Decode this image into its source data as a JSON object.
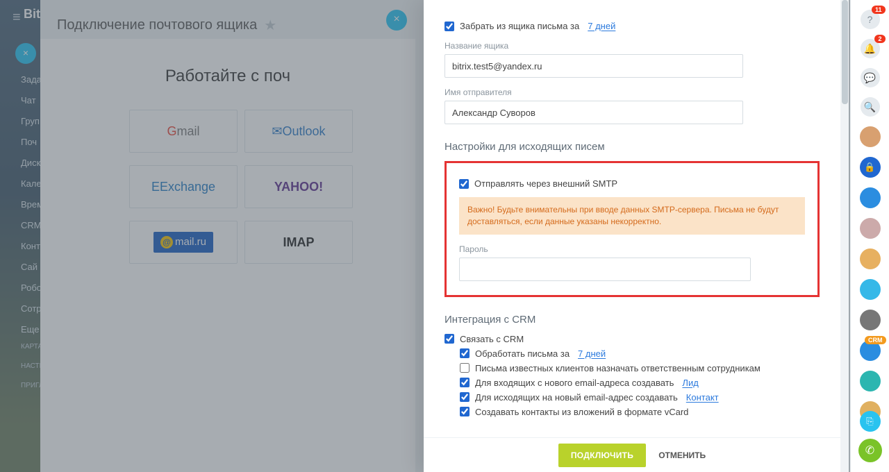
{
  "sidebar": {
    "logo": "Bit",
    "items": [
      "Зада",
      "Чат",
      "Груп",
      "Поч",
      "Диск",
      "Кале",
      "Врем",
      "CRM",
      "Конт",
      "Сай",
      "Робо",
      "Сотр",
      "Еще"
    ],
    "footer": [
      "КАРТА",
      "НАСТР",
      "ПРИГЛ"
    ]
  },
  "modal": {
    "title": "Подключение почтового ящика",
    "h1": "Работайте с поч",
    "providers": [
      "Gmail",
      "Outlook",
      "Exchange",
      "YAHOO!",
      "@mail.ru",
      "IMAP"
    ]
  },
  "panel": {
    "fetch_prefix": "Забрать из ящика письма за",
    "fetch_link": "7 дней",
    "name_label": "Название ящика",
    "name_value": "bitrix.test5@yandex.ru",
    "sender_label": "Имя отправителя",
    "sender_value": "Александр Суворов",
    "out_header": "Настройки для исходящих писем",
    "smtp_label": "Отправлять через внешний SMTP",
    "smtp_warn": "Важно! Будьте внимательны при вводе данных SMTP-сервера. Письма не будут доставляться, если данные указаны некорректно.",
    "pass_label": "Пароль",
    "crm_header": "Интеграция с CRM",
    "crm_link": "Связать с CRM",
    "crm_process_prefix": "Обработать письма за",
    "crm_process_link": "7 дней",
    "crm_known": "Письма известных клиентов назначать ответственным сотрудникам",
    "crm_in_prefix": "Для входящих с нового email-адреса создавать",
    "crm_in_link": "Лид",
    "crm_out_prefix": "Для исходящих на новый email-адрес создавать",
    "crm_out_link": "Контакт",
    "crm_vcard": "Создавать контакты из вложений в формате vCard",
    "submit": "ПОДКЛЮЧИТЬ",
    "cancel": "ОТМЕНИТЬ"
  },
  "rail": {
    "help_badge": "11",
    "bell_badge": "2",
    "crm_badge": "CRM"
  }
}
